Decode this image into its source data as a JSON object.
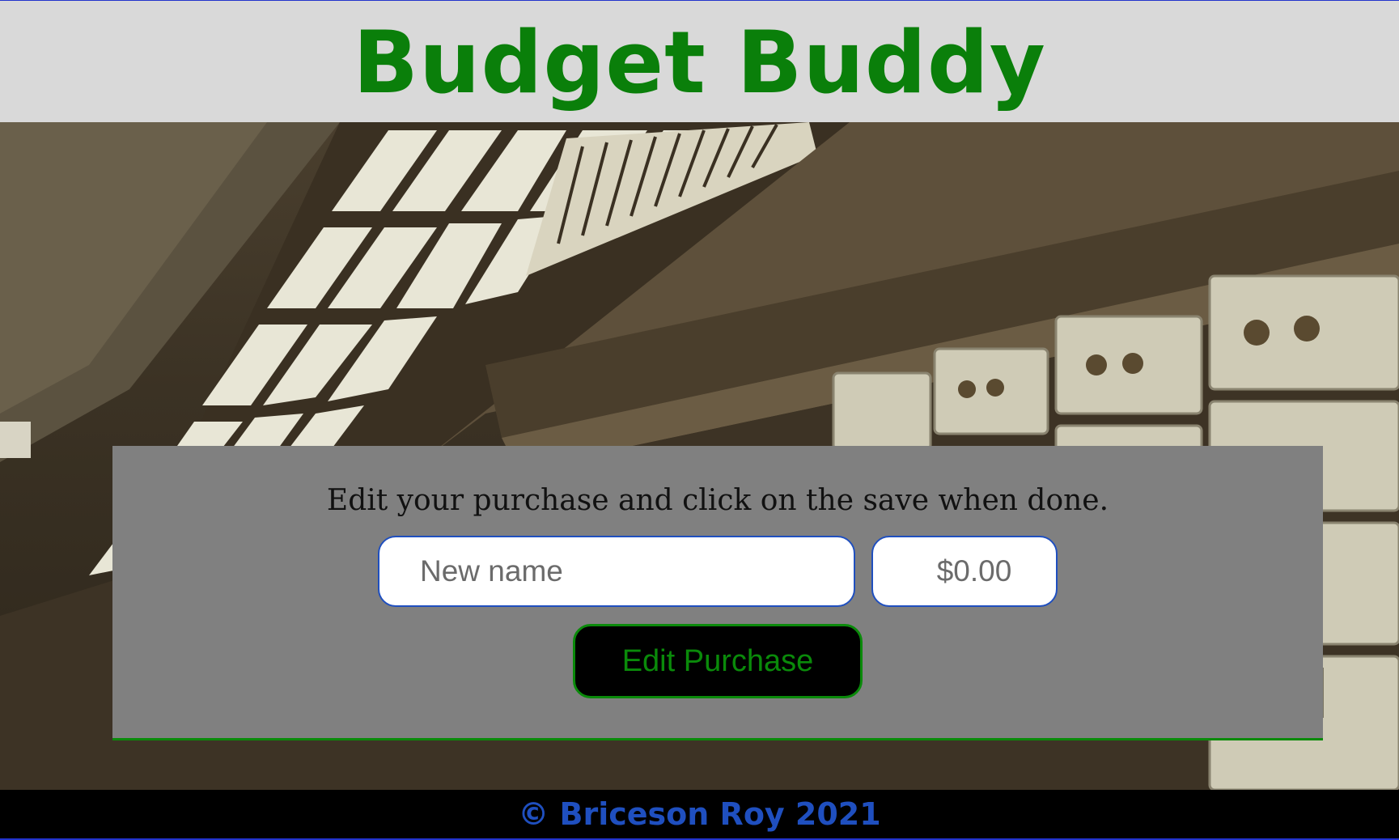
{
  "header": {
    "title": "Budget Buddy"
  },
  "form": {
    "prompt": "Edit your purchase and click on the save when done.",
    "name_placeholder": "New name",
    "name_value": "",
    "price_placeholder": "$0.00",
    "price_value": "",
    "submit_label": "Edit Purchase"
  },
  "footer": {
    "copyright": "© Briceson Roy 2021"
  },
  "colors": {
    "header_bg": "#d9d9d9",
    "title": "#0a7f0a",
    "card_bg": "#808080",
    "accent_green": "#0a8a0a",
    "input_border": "#1f4fbf",
    "footer_bg": "#000000",
    "footer_text": "#1f4fbf"
  },
  "background_image": {
    "subject": "vault-safe-deposit-boxes-photo"
  }
}
